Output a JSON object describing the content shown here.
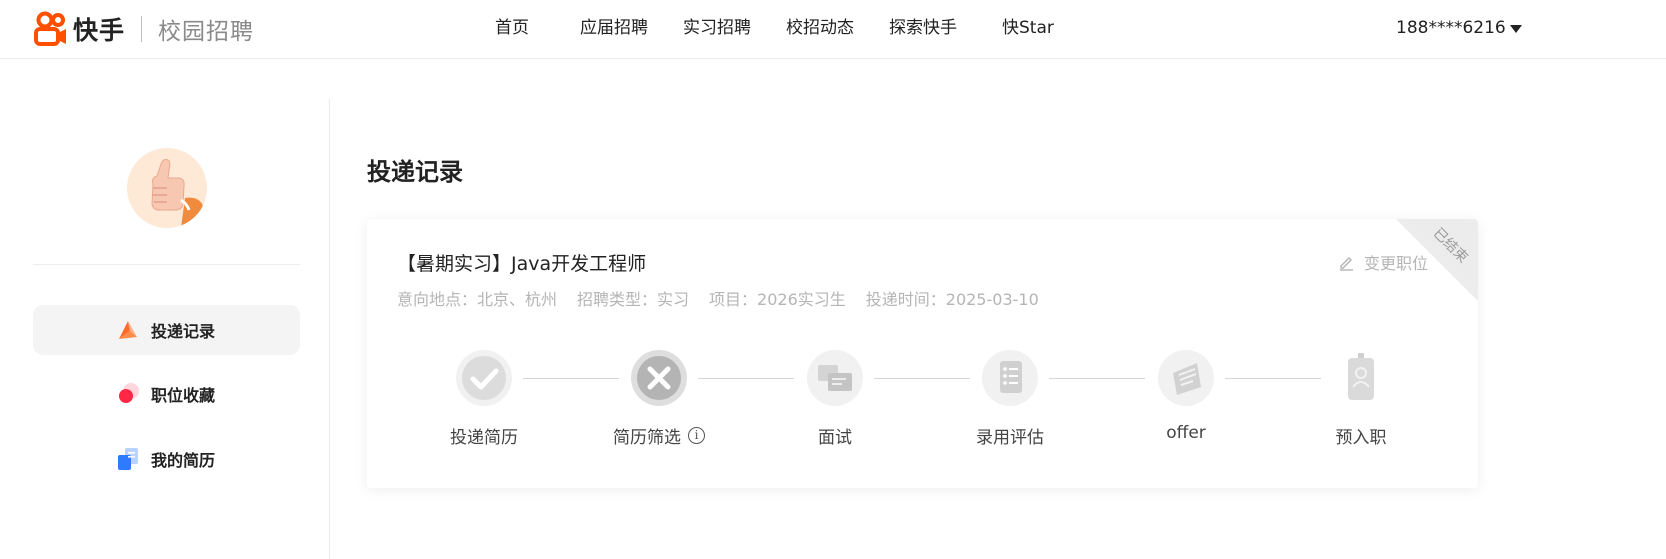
{
  "header": {
    "brand": "快手",
    "subtitle": "校园招聘",
    "nav": [
      "首页",
      "应届招聘",
      "实习招聘",
      "校招动态",
      "探索快手",
      "快Star"
    ],
    "user": "188****6216"
  },
  "sidebar": {
    "items": [
      {
        "label": "投递记录",
        "icon": "rocket-icon",
        "active": true
      },
      {
        "label": "职位收藏",
        "icon": "heart-icon",
        "active": false
      },
      {
        "label": "我的简历",
        "icon": "resume-icon",
        "active": false
      }
    ]
  },
  "main": {
    "title": "投递记录",
    "application": {
      "job_title": "【暑期实习】Java开发工程师",
      "meta": [
        "意向地点：北京、杭州",
        "招聘类型：实习",
        "项目：2026实习生",
        "投递时间：2025-03-10"
      ],
      "change_label": "变更职位",
      "status": "已结束",
      "steps": [
        {
          "label": "投递简历",
          "icon": "check-icon"
        },
        {
          "label": "简历筛选",
          "icon": "reject-icon",
          "info": "i"
        },
        {
          "label": "面试",
          "icon": "interview-icon"
        },
        {
          "label": "录用评估",
          "icon": "evaluation-icon"
        },
        {
          "label": "offer",
          "icon": "offer-icon"
        },
        {
          "label": "预入职",
          "icon": "badge-icon"
        }
      ]
    }
  },
  "colors": {
    "brand": "#ff5000",
    "muted": "#b5b5b5",
    "active_bg": "#f4f4f4"
  }
}
